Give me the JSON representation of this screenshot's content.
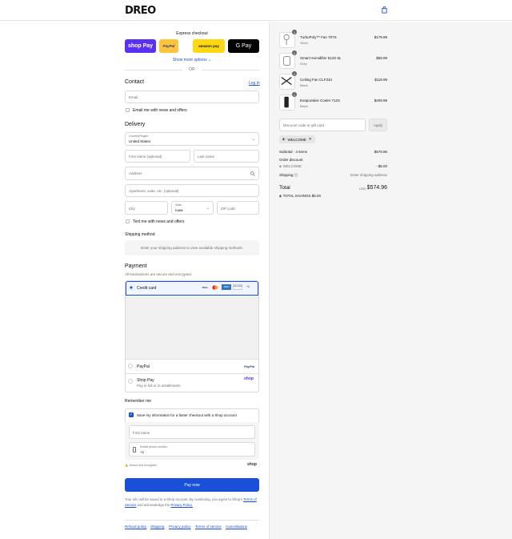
{
  "brand": "DREO",
  "express": {
    "title": "Express checkout",
    "shop_pay": "shop Pay",
    "paypal": "PayPal",
    "amazon_pay": "amazon pay",
    "google_pay": "G Pay",
    "show_more": "Show more options",
    "or": "OR"
  },
  "contact": {
    "title": "Contact",
    "login": "Log in",
    "email_placeholder": "Email",
    "newsletter": "Email me with news and offers"
  },
  "delivery": {
    "title": "Delivery",
    "country_label": "Country/Region",
    "country_value": "United States",
    "first_name": "First name (optional)",
    "last_name": "Last name",
    "address": "Address",
    "apartment": "Apartment, suite, etc. (optional)",
    "city": "City",
    "state_label": "State",
    "state_value": "Iowa",
    "zip": "ZIP code",
    "text_offers": "Text me with news and offers"
  },
  "shipping": {
    "title": "Shipping method",
    "notice": "Enter your shipping address to view available shipping methods."
  },
  "payment": {
    "title": "Payment",
    "subtitle": "All transactions are secure and encrypted.",
    "credit_card": "Credit card",
    "cards": [
      "VISA",
      "MC",
      "AMEX",
      "DISCOVER",
      "+1"
    ],
    "paypal": "PayPal",
    "paypal_logo": "PayPal",
    "shop_pay": "Shop Pay",
    "shop_pay_sub": "Pay in full or in installments",
    "shop_logo": "shop"
  },
  "remember": {
    "title": "Remember me",
    "save_info": "Save my information for a faster checkout with a Shop account",
    "first_name": "First name",
    "phone_label": "Mobile phone number",
    "phone_value": "+1",
    "secure": "Secure and encrypted",
    "shop_logo": "shop"
  },
  "pay_now": "Pay now",
  "legal": {
    "text1": "Your info will be saved to a Shop account. By continuing, you agree to Shop's",
    "terms": "Terms of Service",
    "text2": "and acknowledge the",
    "privacy": "Privacy Policy."
  },
  "footer": [
    "Refund policy",
    "Shipping",
    "Privacy policy",
    "Terms of service",
    "Cancellations"
  ],
  "cart": {
    "items": [
      {
        "name": "TurboPoly™ Fan 707S",
        "variant": "Silver",
        "price": "$179.99",
        "qty": "1"
      },
      {
        "name": "Smart Humidifier 512S 5L",
        "variant": "Grey",
        "price": "$69.99",
        "qty": "1"
      },
      {
        "name": "Ceiling Fan CLF334",
        "variant": "Black",
        "price": "$119.99",
        "qty": "1"
      },
      {
        "name": "Evaporative Cooler 712S",
        "variant": "Black",
        "price": "$209.99",
        "qty": "1"
      }
    ],
    "discount_placeholder": "Discount code or gift card",
    "apply": "Apply",
    "applied_code": "WELCOME",
    "subtotal_label": "Subtotal · 4 items",
    "subtotal_value": "$579.96",
    "order_discount": "Order discount",
    "discount_code": "WELCOME",
    "discount_value": "- $5.00",
    "shipping_label": "Shipping",
    "shipping_value": "Enter shipping address",
    "total_label": "Total",
    "currency": "USD",
    "total_value": "$574.96",
    "savings_label": "TOTAL SAVINGS",
    "savings_value": "$5.00"
  },
  "colors": {
    "accent": "#1a4fd8",
    "shop_purple": "#5a31f4",
    "paypal_yellow": "#ffc439",
    "amazon_yellow": "#ffd814"
  }
}
